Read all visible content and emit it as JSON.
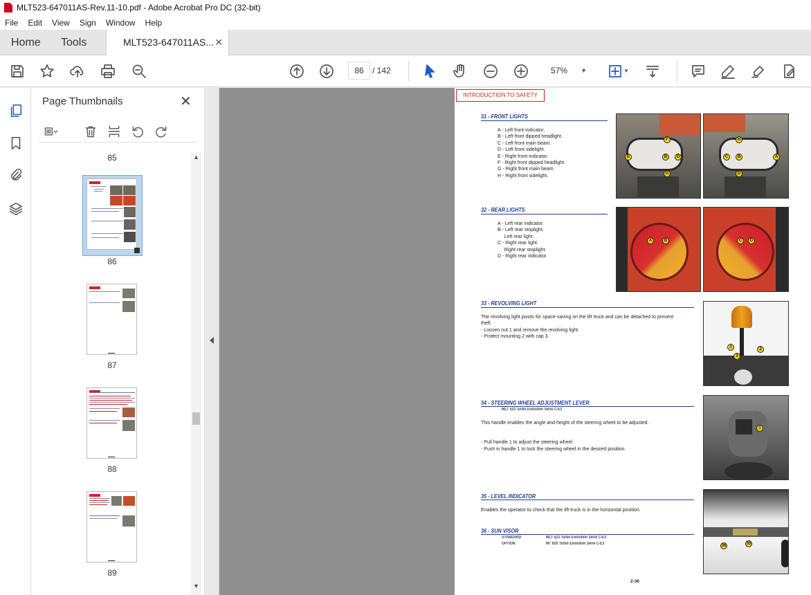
{
  "window": {
    "title": "MLT523-647011AS-Rev.11-10.pdf - Adobe Acrobat Pro DC (32-bit)"
  },
  "menu": [
    "File",
    "Edit",
    "View",
    "Sign",
    "Window",
    "Help"
  ],
  "tabs": {
    "home": "Home",
    "tools": "Tools",
    "document": "MLT523-647011AS..."
  },
  "toolbar": {
    "current_page": "86",
    "total_pages": "/ 142",
    "zoom": "57%"
  },
  "panel": {
    "title": "Page Thumbnails",
    "pages": [
      "85",
      "86",
      "87",
      "88",
      "89"
    ],
    "selected_page": "86"
  },
  "document": {
    "header_tag": "INTRODUCTION TO SAFETY",
    "page_number": "2-36",
    "sections": {
      "front_lights": {
        "title": "31 - FRONT LIGHTS",
        "body": "A - Left front indicator.\nB - Left front dipped headlight.\nC - Left front main beam.\nD - Left front sidelight.\nE - Right front indicator.\nF - Right front dipped headlight.\nG - Right front main beam.\nH - Right front sidelight."
      },
      "rear_lights": {
        "title": "32 - REAR LIGHTS",
        "body": "A - Left rear indicator.\nB - Left rear stoplight.\n     Left rear light.\nC - Right rear light.\n     Right rear stoplight.\nD - Right rear indicator."
      },
      "revolving_light": {
        "title": "33 - REVOLVING LIGHT",
        "body": "The revolving light pivots for space-saving on the lift truck and can be detached to prevent\ntheft.\n- Loosen nut 1 and remove the revolving light.\n- Protect mounting 2 with cap 3."
      },
      "steering": {
        "title": "34 - STEERING WHEEL ADJUSTMENT LEVER",
        "subtitle": "MLT 523 Turbo Evolution Série C-E3",
        "body": "This handle enables the angle and height of the steering wheel to be adjusted.\n\n\n- Pull handle 1 to adjust the steering wheel.\n- Push in handle 1 to lock the steering wheel in the desired position."
      },
      "level": {
        "title": "35 - LEVEL INDICATOR",
        "body": "Enables the operator to check that the lift truck is in the horizontal position."
      },
      "sun_visor": {
        "title": "36 - SUN VISOR",
        "standard_label": "STANDARD",
        "standard_value": "MLT 523 Turbo Evolution Série C-E3",
        "option_label": "OPTION",
        "option_value": "MT 620 Turbo Evolution Série C-E3"
      }
    },
    "markers": {
      "front_left": [
        "F",
        "E",
        "B",
        "D",
        "G"
      ],
      "front_right": [
        "H",
        "C",
        "A",
        "B",
        "D"
      ],
      "rear_left": [
        "A",
        "B"
      ],
      "rear_right": [
        "C",
        "D"
      ],
      "revolving": [
        "1",
        "2",
        "3"
      ],
      "steering": [
        "1"
      ],
      "level": [
        "36",
        "35"
      ]
    }
  }
}
